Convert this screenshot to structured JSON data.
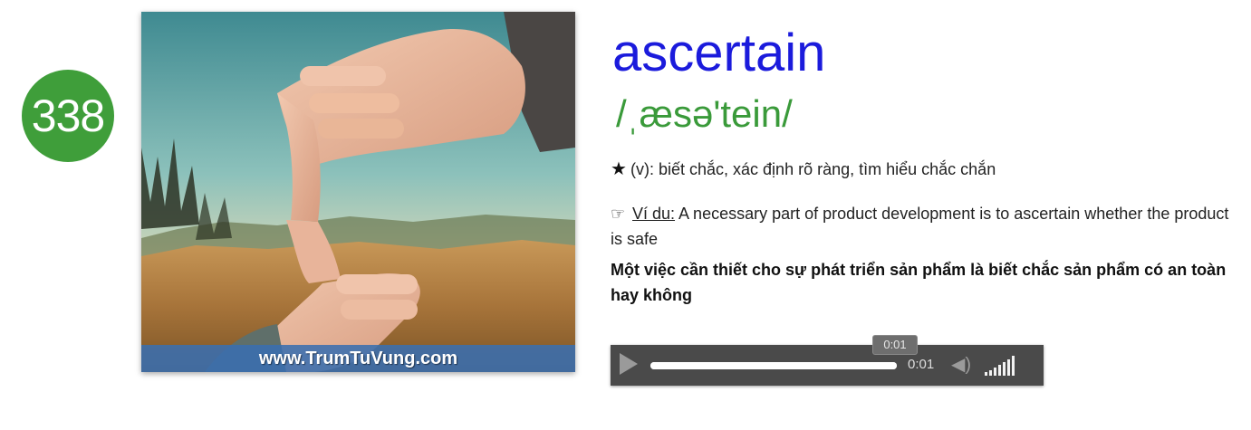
{
  "card": {
    "number": "338",
    "image_watermark": "www.TrumTuVung.com",
    "word": "ascertain",
    "ipa": "/ˌæsə'tein/",
    "definition": {
      "icon": "star-icon",
      "text": "(v): biết chắc, xác định rõ ràng, tìm hiểu chắc chắn"
    },
    "example": {
      "icon": "pointing-hand-icon",
      "label": "Ví du:",
      "english": "A necessary part of product development is to ascertain whether the product is safe",
      "vietnamese": "Một việc cần thiết cho sự phát triển sản phẩm là biết chắc sản phẩm có an toàn hay không"
    }
  },
  "audio_player": {
    "tooltip_time": "0:01",
    "current_time": "0:01",
    "progress": 1.0,
    "volume_level": 1.0
  },
  "colors": {
    "badge": "#3f9e3a",
    "word": "#1b1bdc",
    "ipa": "#3a9a3a",
    "player_bg": "#4a4a4a"
  }
}
